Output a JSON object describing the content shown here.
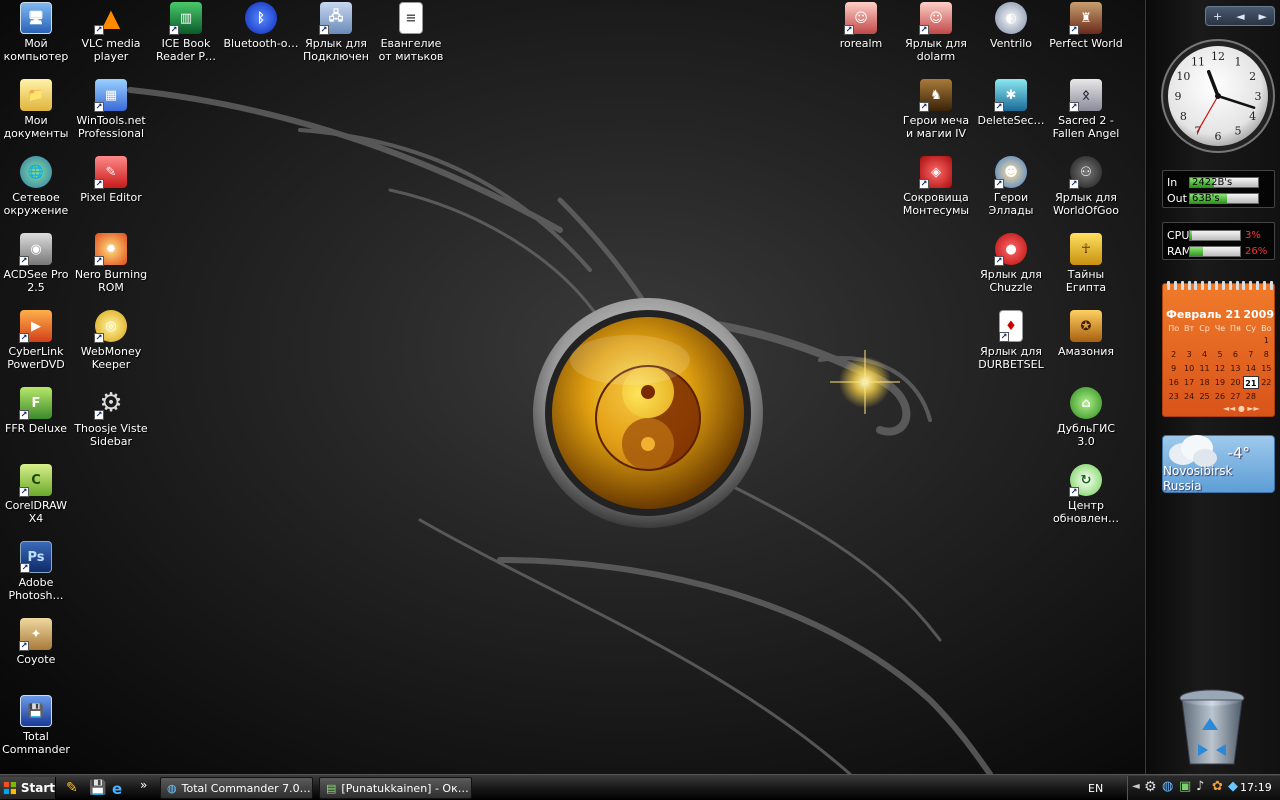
{
  "desktop": {
    "left_column_1": [
      {
        "label": "Мой компьютер",
        "icon": "computer-icon"
      },
      {
        "label": "Мои документы",
        "icon": "documents-folder-icon"
      },
      {
        "label": "Сетевое окружение",
        "icon": "network-icon"
      },
      {
        "label": "ACDSee Pro 2.5",
        "icon": "camera-icon"
      },
      {
        "label": "CyberLink PowerDVD",
        "icon": "dvd-player-icon"
      },
      {
        "label": "FFR Deluxe",
        "icon": "ffr-icon"
      },
      {
        "label": "CorelDRAW X4",
        "icon": "coreldraw-icon"
      },
      {
        "label": "Adobe Photosh…",
        "icon": "photoshop-icon"
      },
      {
        "label": "Coyote",
        "icon": "coyote-icon"
      },
      {
        "label": "Total Commander",
        "icon": "floppy-icon"
      }
    ],
    "left_column_2": [
      {
        "label": "VLC media player",
        "icon": "vlc-cone-icon"
      },
      {
        "label": "WinTools.net Professional",
        "icon": "wintools-icon"
      },
      {
        "label": "Pixel Editor",
        "icon": "pixel-editor-icon"
      },
      {
        "label": "Nero Burning ROM",
        "icon": "nero-icon"
      },
      {
        "label": "WebMoney Keeper Clas…",
        "icon": "webmoney-icon"
      },
      {
        "label": "Thoosje Viste Sidebar",
        "icon": "gear-icon"
      }
    ],
    "top_row": [
      {
        "label": "ICE Book Reader P…",
        "icon": "book-icon"
      },
      {
        "label": "Bluetooth-о…",
        "icon": "bluetooth-icon"
      },
      {
        "label": "Ярлык для Подключен…",
        "icon": "network-connection-icon"
      },
      {
        "label": "Евангелие от митьков",
        "icon": "text-document-icon"
      }
    ],
    "right_column_1": [
      {
        "label": "rorealm",
        "icon": "anime-face-icon"
      }
    ],
    "right_column_2": [
      {
        "label": "Ярлык для dolarm",
        "icon": "anime-face-icon"
      },
      {
        "label": "Герои меча и магии IV Г…",
        "icon": "heroes-icon"
      },
      {
        "label": "Сокровища Монтесумы",
        "icon": "montezuma-icon"
      }
    ],
    "right_column_3": [
      {
        "label": "Ventrilo",
        "icon": "ventrilo-headset-icon"
      },
      {
        "label": "DeleteSec…",
        "icon": "deletesec-icon"
      },
      {
        "label": "Герои Эллады",
        "icon": "hellas-icon"
      },
      {
        "label": "Ярлык для Chuzzle",
        "icon": "chuzzle-icon"
      },
      {
        "label": "Ярлык для DURBETSEL",
        "icon": "playing-card-icon"
      }
    ],
    "right_column_4": [
      {
        "label": "Perfect World",
        "icon": "perfect-world-icon"
      },
      {
        "label": "Sacred 2 - Fallen Angel",
        "icon": "sacred-icon"
      },
      {
        "label": "Ярлык для WorldOfGoo",
        "icon": "worldofgoo-icon"
      },
      {
        "label": "Тайны Египта",
        "icon": "ankh-icon"
      },
      {
        "label": "Амазония",
        "icon": "amazonia-icon"
      },
      {
        "label": "ДубльГИС 3.0",
        "icon": "dublgis-icon"
      },
      {
        "label": "Центр обновлен…",
        "icon": "update-center-icon"
      }
    ]
  },
  "sidebar": {
    "controls": [
      "+",
      "◄",
      "►"
    ],
    "clock": {
      "hour": 11,
      "minute": 18,
      "second": 35
    },
    "network": {
      "in_label": "In",
      "in_value": "2422B's",
      "in_fraction": 0.35,
      "out_label": "Out",
      "out_value": "63B's",
      "out_fraction": 0.55
    },
    "system": {
      "cpu_label": "CPU",
      "cpu_pct": "3%",
      "cpu_fraction": 0.03,
      "ram_label": "RAM",
      "ram_pct": "26%",
      "ram_fraction": 0.26
    },
    "calendar": {
      "month_day": "Февраль 21",
      "year": "2009",
      "weekdays": [
        "По",
        "Вт",
        "Ср",
        "Че",
        "Пя",
        "Су",
        "Во"
      ],
      "leading_blanks": 6,
      "days": 28,
      "today": 21,
      "nav": "◄◄  ●  ►►"
    },
    "weather": {
      "temp": "-4°",
      "city": "Novosibirsk",
      "country": "Russia"
    }
  },
  "taskbar": {
    "start_label": "Start",
    "tasks": [
      {
        "label": "Total Commander 7.0…"
      },
      {
        "label": "[Punatukkainen] - Ок…"
      }
    ],
    "language": "EN",
    "time": "17:19"
  },
  "colors": {
    "accent_orange": "#e8661f",
    "weather_blue": "#6fa8dc",
    "meter_green": "#3fae2a"
  }
}
